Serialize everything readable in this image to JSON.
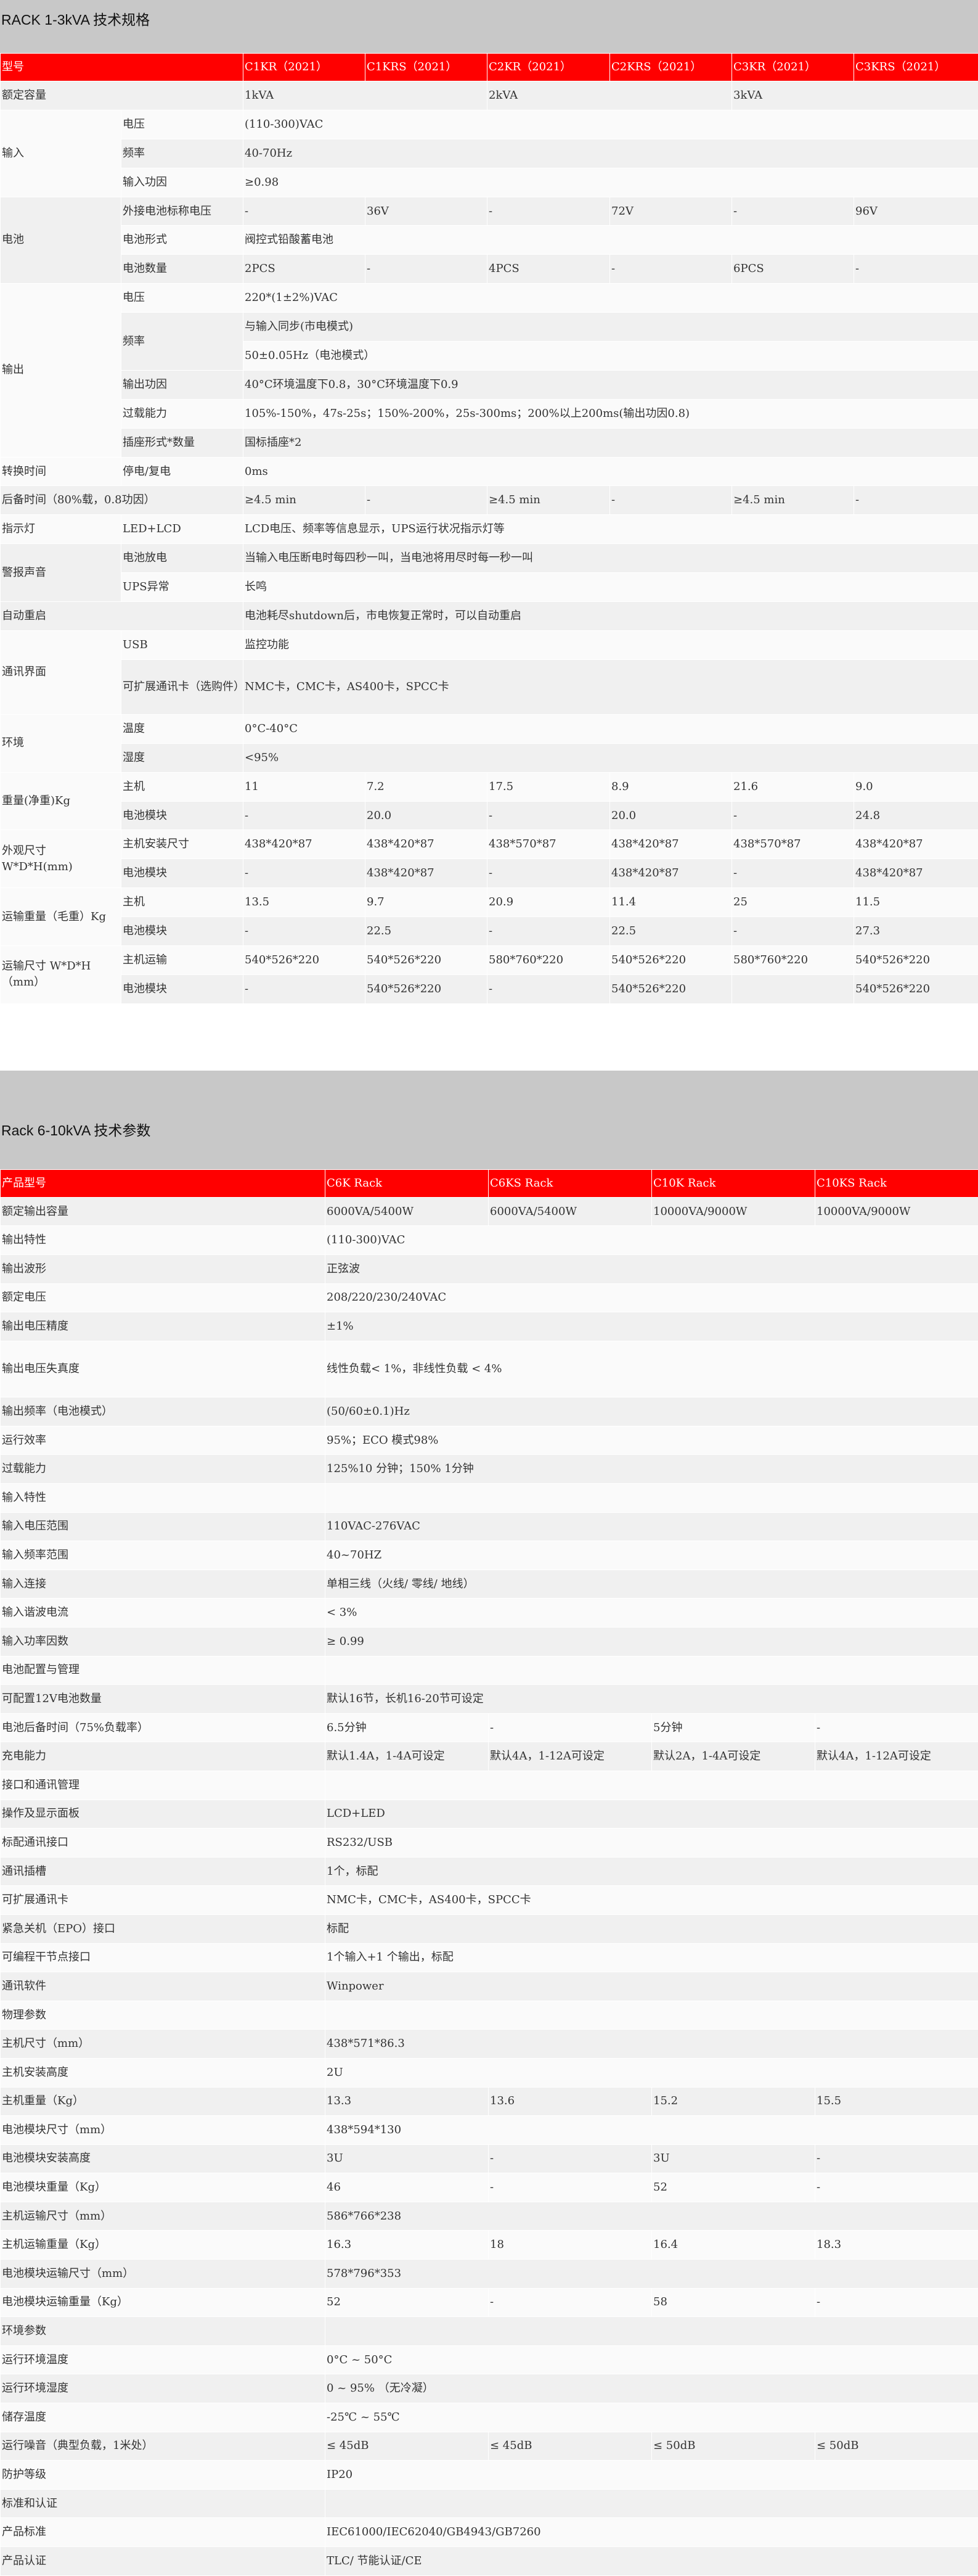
{
  "section1": {
    "title": "RACK 1-3kVA  技术规格",
    "header": [
      "型号",
      "C1KR（2021）",
      "C1KRS（2021）",
      "C2KR（2021）",
      "C2KRS（2021）",
      "C3KR（2021）",
      "C3KRS（2021）"
    ],
    "rows": [
      {
        "c": [
          {
            "t": "额定容量",
            "cs": 2
          },
          {
            "t": "1kVA",
            "cs": 2
          },
          {
            "t": "2kVA",
            "cs": 2
          },
          {
            "t": "3kVA",
            "cs": 2
          }
        ]
      },
      {
        "c": [
          {
            "t": "输入",
            "rs": 3
          },
          {
            "t": "电压"
          },
          {
            "t": "(110-300)VAC",
            "cs": 6
          }
        ]
      },
      {
        "c": [
          {
            "t": "频率"
          },
          {
            "t": "40-70Hz",
            "cs": 6
          }
        ]
      },
      {
        "c": [
          {
            "t": "输入功因"
          },
          {
            "t": "≥0.98",
            "cs": 6
          }
        ]
      },
      {
        "c": [
          {
            "t": "电池",
            "rs": 3
          },
          {
            "t": "外接电池标称电压"
          },
          {
            "t": "-"
          },
          {
            "t": "36V"
          },
          {
            "t": "-"
          },
          {
            "t": "72V"
          },
          {
            "t": "-"
          },
          {
            "t": "96V"
          }
        ]
      },
      {
        "c": [
          {
            "t": "电池形式"
          },
          {
            "t": "阀控式铅酸蓄电池",
            "cs": 6
          }
        ]
      },
      {
        "c": [
          {
            "t": "电池数量"
          },
          {
            "t": "2PCS"
          },
          {
            "t": "-"
          },
          {
            "t": "4PCS"
          },
          {
            "t": "-"
          },
          {
            "t": "6PCS"
          },
          {
            "t": "-"
          }
        ]
      },
      {
        "c": [
          {
            "t": "输出",
            "rs": 6
          },
          {
            "t": "电压"
          },
          {
            "t": "220*(1±2%)VAC",
            "cs": 6
          }
        ]
      },
      {
        "c": [
          {
            "t": "频率",
            "rs": 2
          },
          {
            "t": "与输入同步(市电模式)",
            "cs": 6
          }
        ]
      },
      {
        "c": [
          {
            "t": "50±0.05Hz（电池模式）",
            "cs": 6
          }
        ]
      },
      {
        "c": [
          {
            "t": "输出功因"
          },
          {
            "t": "40°C环境温度下0.8，30°C环境温度下0.9",
            "cs": 6
          }
        ]
      },
      {
        "c": [
          {
            "t": "过载能力"
          },
          {
            "t": "105%-150%，47s-25s；150%-200%，25s-300ms；200%以上200ms(输出功因0.8)",
            "cs": 6
          }
        ]
      },
      {
        "c": [
          {
            "t": "插座形式*数量"
          },
          {
            "t": "国标插座*2",
            "cs": 6
          }
        ]
      },
      {
        "c": [
          {
            "t": "转换时间"
          },
          {
            "t": "停电/复电"
          },
          {
            "t": "0ms",
            "cs": 6
          }
        ]
      },
      {
        "c": [
          {
            "t": "后备时间（80%载，0.8功因）",
            "cs": 2
          },
          {
            "t": "≥4.5 min"
          },
          {
            "t": "-"
          },
          {
            "t": "≥4.5 min"
          },
          {
            "t": "-"
          },
          {
            "t": "≥4.5 min"
          },
          {
            "t": "-"
          }
        ]
      },
      {
        "c": [
          {
            "t": "指示灯"
          },
          {
            "t": "LED+LCD"
          },
          {
            "t": "LCD电压、频率等信息显示，UPS运行状况指示灯等",
            "cs": 6
          }
        ]
      },
      {
        "c": [
          {
            "t": "警报声音",
            "rs": 2
          },
          {
            "t": "电池放电"
          },
          {
            "t": "当输入电压断电时每四秒一叫，当电池将用尽时每一秒一叫",
            "cs": 6
          }
        ]
      },
      {
        "c": [
          {
            "t": "UPS异常"
          },
          {
            "t": "长鸣",
            "cs": 6
          }
        ]
      },
      {
        "c": [
          {
            "t": "自动重启",
            "cs": 2
          },
          {
            "t": "电池耗尽shutdown后，市电恢复正常时，可以自动重启",
            "cs": 6
          }
        ]
      },
      {
        "c": [
          {
            "t": "通讯界面",
            "rs": 2
          },
          {
            "t": "USB"
          },
          {
            "t": "监控功能",
            "cs": 6
          }
        ]
      },
      {
        "c": [
          {
            "t": "可扩展通讯卡（选购件）"
          },
          {
            "t": "NMC卡，CMC卡，AS400卡，SPCC卡",
            "cs": 6
          }
        ],
        "h": 1.9
      },
      {
        "c": [
          {
            "t": "环境",
            "rs": 2
          },
          {
            "t": "温度"
          },
          {
            "t": "0°C-40°C",
            "cs": 6
          }
        ]
      },
      {
        "c": [
          {
            "t": "湿度"
          },
          {
            "t": "<95%",
            "cs": 6
          }
        ]
      },
      {
        "c": [
          {
            "t": "重量(净重)Kg",
            "rs": 2
          },
          {
            "t": "主机"
          },
          {
            "t": "11"
          },
          {
            "t": "7.2"
          },
          {
            "t": "17.5"
          },
          {
            "t": "8.9"
          },
          {
            "t": "21.6"
          },
          {
            "t": "9.0"
          }
        ]
      },
      {
        "c": [
          {
            "t": "电池模块"
          },
          {
            "t": "-"
          },
          {
            "t": "20.0"
          },
          {
            "t": "-"
          },
          {
            "t": "20.0"
          },
          {
            "t": "-"
          },
          {
            "t": "24.8"
          }
        ]
      },
      {
        "c": [
          {
            "t": "外观尺寸 W*D*H(mm)",
            "rs": 2
          },
          {
            "t": "主机安装尺寸"
          },
          {
            "t": "438*420*87"
          },
          {
            "t": "438*420*87"
          },
          {
            "t": "438*570*87"
          },
          {
            "t": "438*420*87"
          },
          {
            "t": "438*570*87"
          },
          {
            "t": "438*420*87"
          }
        ]
      },
      {
        "c": [
          {
            "t": "电池模块"
          },
          {
            "t": "-"
          },
          {
            "t": "438*420*87"
          },
          {
            "t": "-"
          },
          {
            "t": "438*420*87"
          },
          {
            "t": "-"
          },
          {
            "t": "438*420*87"
          }
        ]
      },
      {
        "c": [
          {
            "t": "运输重量（毛重）Kg",
            "rs": 2
          },
          {
            "t": "主机"
          },
          {
            "t": "13.5"
          },
          {
            "t": "9.7"
          },
          {
            "t": "20.9"
          },
          {
            "t": "11.4"
          },
          {
            "t": "25"
          },
          {
            "t": "11.5"
          }
        ]
      },
      {
        "c": [
          {
            "t": "电池模块"
          },
          {
            "t": "-"
          },
          {
            "t": "22.5"
          },
          {
            "t": "-"
          },
          {
            "t": "22.5"
          },
          {
            "t": "-"
          },
          {
            "t": "27.3"
          }
        ]
      },
      {
        "c": [
          {
            "t": "运输尺寸 W*D*H（mm）",
            "rs": 2
          },
          {
            "t": "主机运输"
          },
          {
            "t": "540*526*220"
          },
          {
            "t": "540*526*220"
          },
          {
            "t": "580*760*220"
          },
          {
            "t": "540*526*220"
          },
          {
            "t": "580*760*220"
          },
          {
            "t": "540*526*220"
          }
        ]
      },
      {
        "c": [
          {
            "t": "电池模块"
          },
          {
            "t": "-"
          },
          {
            "t": "540*526*220"
          },
          {
            "t": "-"
          },
          {
            "t": "540*526*220"
          },
          {
            "t": ""
          },
          {
            "t": "540*526*220"
          }
        ]
      }
    ]
  },
  "section2": {
    "title": "Rack 6-10kVA  技术参数",
    "header": [
      "产品型号",
      "C6K Rack",
      "C6KS Rack",
      "C10K Rack",
      "C10KS Rack"
    ],
    "rows": [
      {
        "c": [
          {
            "t": "额定输出容量"
          },
          {
            "t": "6000VA/5400W"
          },
          {
            "t": "6000VA/5400W"
          },
          {
            "t": "10000VA/9000W"
          },
          {
            "t": "10000VA/9000W"
          }
        ]
      },
      {
        "c": [
          {
            "t": "输出特性"
          },
          {
            "t": "(110-300)VAC",
            "cs": 4
          }
        ]
      },
      {
        "c": [
          {
            "t": "输出波形"
          },
          {
            "t": "正弦波",
            "cs": 4
          }
        ]
      },
      {
        "c": [
          {
            "t": "额定电压"
          },
          {
            "t": "208/220/230/240VAC",
            "cs": 4
          }
        ]
      },
      {
        "c": [
          {
            "t": "输出电压精度"
          },
          {
            "t": "±1%",
            "cs": 4
          }
        ]
      },
      {
        "c": [
          {
            "t": "输出电压失真度"
          },
          {
            "t": "线性负载< 1%，非线性负载 < 4%",
            "cs": 4
          }
        ],
        "h": 1.95
      },
      {
        "c": [
          {
            "t": "输出频率（电池模式）"
          },
          {
            "t": "(50/60±0.1)Hz",
            "cs": 4
          }
        ]
      },
      {
        "c": [
          {
            "t": "运行效率"
          },
          {
            "t": "95%；ECO 模式98%",
            "cs": 4
          }
        ]
      },
      {
        "c": [
          {
            "t": "过载能力"
          },
          {
            "t": "125%10 分钟；150% 1分钟",
            "cs": 4
          }
        ]
      },
      {
        "c": [
          {
            "t": "输入特性"
          },
          {
            "t": "",
            "cs": 4
          }
        ]
      },
      {
        "c": [
          {
            "t": "输入电压范围"
          },
          {
            "t": "110VAC-276VAC",
            "cs": 4
          }
        ]
      },
      {
        "c": [
          {
            "t": "输入频率范围"
          },
          {
            "t": "40~70HZ",
            "cs": 4
          }
        ]
      },
      {
        "c": [
          {
            "t": "输入连接"
          },
          {
            "t": "单相三线（火线/ 零线/ 地线）",
            "cs": 4
          }
        ]
      },
      {
        "c": [
          {
            "t": "输入谐波电流"
          },
          {
            "t": "< 3%",
            "cs": 4
          }
        ]
      },
      {
        "c": [
          {
            "t": "输入功率因数"
          },
          {
            "t": "≥ 0.99",
            "cs": 4
          }
        ]
      },
      {
        "c": [
          {
            "t": "电池配置与管理"
          },
          {
            "t": "",
            "cs": 4
          }
        ]
      },
      {
        "c": [
          {
            "t": "可配置12V电池数量"
          },
          {
            "t": "默认16节，长机16-20节可设定",
            "cs": 4
          }
        ]
      },
      {
        "c": [
          {
            "t": "电池后备时间（75%负载率）"
          },
          {
            "t": "6.5分钟"
          },
          {
            "t": "-"
          },
          {
            "t": "5分钟"
          },
          {
            "t": "-"
          }
        ]
      },
      {
        "c": [
          {
            "t": "充电能力"
          },
          {
            "t": "默认1.4A，1-4A可设定"
          },
          {
            "t": "默认4A，1-12A可设定"
          },
          {
            "t": "默认2A，1-4A可设定"
          },
          {
            "t": "默认4A，1-12A可设定"
          }
        ]
      },
      {
        "c": [
          {
            "t": "接口和通讯管理"
          },
          {
            "t": "",
            "cs": 4
          }
        ]
      },
      {
        "c": [
          {
            "t": "操作及显示面板"
          },
          {
            "t": "LCD+LED",
            "cs": 4
          }
        ]
      },
      {
        "c": [
          {
            "t": "标配通讯接口"
          },
          {
            "t": "RS232/USB",
            "cs": 4
          }
        ]
      },
      {
        "c": [
          {
            "t": "通讯插槽"
          },
          {
            "t": "1个，标配",
            "cs": 4
          }
        ]
      },
      {
        "c": [
          {
            "t": "可扩展通讯卡"
          },
          {
            "t": "NMC卡，CMC卡，AS400卡，SPCC卡",
            "cs": 4
          }
        ]
      },
      {
        "c": [
          {
            "t": "紧急关机（EPO）接口"
          },
          {
            "t": "标配",
            "cs": 4
          }
        ]
      },
      {
        "c": [
          {
            "t": "可编程干节点接口"
          },
          {
            "t": "1个输入+1 个输出，标配",
            "cs": 4
          }
        ]
      },
      {
        "c": [
          {
            "t": "通讯软件"
          },
          {
            "t": "Winpower",
            "cs": 4
          }
        ]
      },
      {
        "c": [
          {
            "t": "物理参数"
          },
          {
            "t": "",
            "cs": 4
          }
        ]
      },
      {
        "c": [
          {
            "t": "主机尺寸（mm）"
          },
          {
            "t": "438*571*86.3",
            "cs": 4
          }
        ]
      },
      {
        "c": [
          {
            "t": "主机安装高度"
          },
          {
            "t": "2U",
            "cs": 4
          }
        ]
      },
      {
        "c": [
          {
            "t": "主机重量（Kg）"
          },
          {
            "t": "13.3"
          },
          {
            "t": "13.6"
          },
          {
            "t": "15.2"
          },
          {
            "t": "15.5"
          }
        ]
      },
      {
        "c": [
          {
            "t": "电池模块尺寸（mm）"
          },
          {
            "t": "438*594*130",
            "cs": 4
          }
        ]
      },
      {
        "c": [
          {
            "t": "电池模块安装高度"
          },
          {
            "t": "3U"
          },
          {
            "t": "-"
          },
          {
            "t": "3U"
          },
          {
            "t": "-"
          }
        ]
      },
      {
        "c": [
          {
            "t": "电池模块重量（Kg）"
          },
          {
            "t": "46"
          },
          {
            "t": "-"
          },
          {
            "t": "52"
          },
          {
            "t": "-"
          }
        ]
      },
      {
        "c": [
          {
            "t": "主机运输尺寸（mm）"
          },
          {
            "t": "586*766*238",
            "cs": 4
          }
        ]
      },
      {
        "c": [
          {
            "t": "主机运输重量（Kg）"
          },
          {
            "t": "16.3"
          },
          {
            "t": "18"
          },
          {
            "t": "16.4"
          },
          {
            "t": "18.3"
          }
        ]
      },
      {
        "c": [
          {
            "t": "电池模块运输尺寸（mm）"
          },
          {
            "t": "578*796*353",
            "cs": 4
          }
        ]
      },
      {
        "c": [
          {
            "t": "电池模块运输重量（Kg）"
          },
          {
            "t": "52"
          },
          {
            "t": "-"
          },
          {
            "t": "58"
          },
          {
            "t": "-"
          }
        ]
      },
      {
        "c": [
          {
            "t": "环境参数"
          },
          {
            "t": "",
            "cs": 4
          }
        ]
      },
      {
        "c": [
          {
            "t": "运行环境温度"
          },
          {
            "t": "0°C ~ 50°C",
            "cs": 4
          }
        ]
      },
      {
        "c": [
          {
            "t": "运行环境湿度"
          },
          {
            "t": "0 ~ 95% （无冷凝）",
            "cs": 4
          }
        ]
      },
      {
        "c": [
          {
            "t": "储存温度"
          },
          {
            "t": "-25℃ ~ 55℃",
            "cs": 4
          }
        ]
      },
      {
        "c": [
          {
            "t": "运行噪音（典型负载，1米处）"
          },
          {
            "t": "≤ 45dB"
          },
          {
            "t": "≤ 45dB"
          },
          {
            "t": "≤ 50dB"
          },
          {
            "t": "≤ 50dB"
          }
        ]
      },
      {
        "c": [
          {
            "t": "防护等级"
          },
          {
            "t": "IP20",
            "cs": 4
          }
        ]
      },
      {
        "c": [
          {
            "t": "标准和认证"
          },
          {
            "t": "",
            "cs": 4
          }
        ]
      },
      {
        "c": [
          {
            "t": "产品标准"
          },
          {
            "t": "IEC61000/IEC62040/GB4943/GB7260",
            "cs": 4
          }
        ]
      },
      {
        "c": [
          {
            "t": "产品认证"
          },
          {
            "t": "TLC/ 节能认证/CE",
            "cs": 4
          }
        ]
      }
    ]
  }
}
